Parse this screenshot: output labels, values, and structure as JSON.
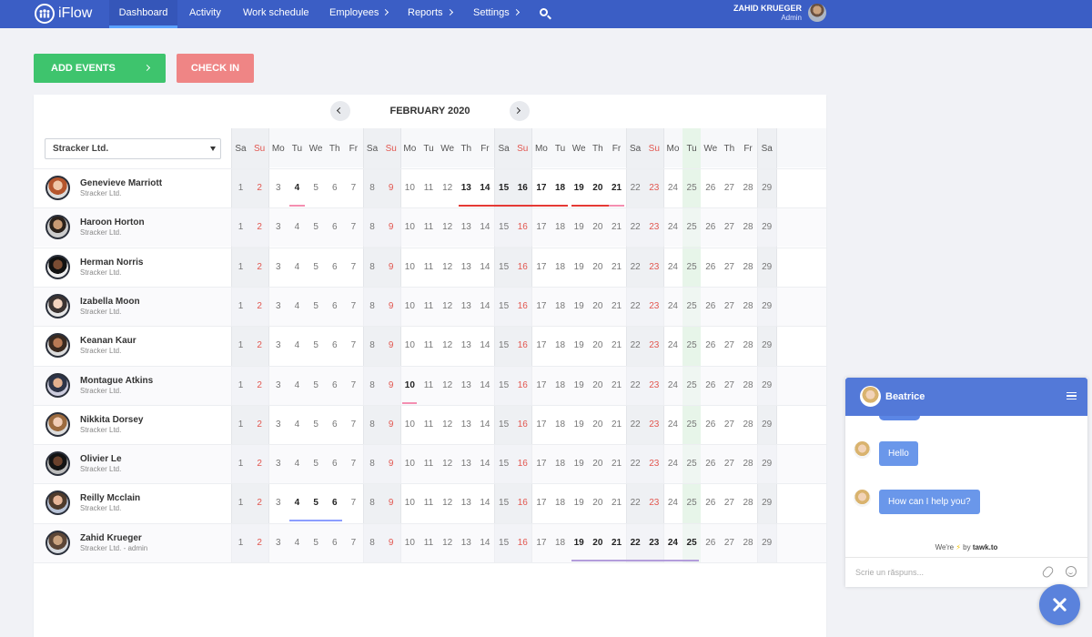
{
  "app": {
    "name": "iFlow"
  },
  "nav": {
    "items": [
      {
        "label": "Dashboard",
        "active": true,
        "chevron": false
      },
      {
        "label": "Activity",
        "chevron": false
      },
      {
        "label": "Work schedule",
        "chevron": false
      },
      {
        "label": "Employees",
        "chevron": true
      },
      {
        "label": "Reports",
        "chevron": true
      },
      {
        "label": "Settings",
        "chevron": true
      }
    ],
    "search_icon": "search-icon"
  },
  "user": {
    "name": "ZAHID KRUEGER",
    "role": "Admin"
  },
  "actions": {
    "add_events_label": "ADD EVENTS",
    "check_in_label": "CHECK IN"
  },
  "calendar": {
    "month_label": "FEBRUARY 2020",
    "company_filter": "Stracker Ltd.",
    "day_names": [
      "Sa",
      "Su",
      "Mo",
      "Tu",
      "We",
      "Th",
      "Fr",
      "Sa",
      "Su",
      "Mo",
      "Tu",
      "We",
      "Th",
      "Fr",
      "Sa",
      "Su",
      "Mo",
      "Tu",
      "We",
      "Th",
      "Fr",
      "Sa",
      "Su",
      "Mo",
      "Tu",
      "We",
      "Th",
      "Fr",
      "Sa"
    ],
    "dates": [
      "1",
      "2",
      "3",
      "4",
      "5",
      "6",
      "7",
      "8",
      "9",
      "10",
      "11",
      "12",
      "13",
      "14",
      "15",
      "16",
      "17",
      "18",
      "19",
      "20",
      "21",
      "22",
      "23",
      "24",
      "25",
      "26",
      "27",
      "28",
      "29"
    ],
    "weekend_dates": [
      1,
      2,
      8,
      9,
      15,
      16,
      22,
      23,
      29
    ],
    "sunday_dates": [
      2,
      9,
      16,
      23
    ],
    "today": 25,
    "employees": [
      {
        "name": "Genevieve Marriott",
        "company": "Stracker Ltd.",
        "bold_dates": [
          4,
          13,
          14,
          15,
          16,
          17,
          18,
          19,
          20,
          21
        ],
        "events": [
          {
            "from": 4,
            "to": 4,
            "color": "#f48fb1"
          },
          {
            "from": 13,
            "to": 18,
            "color": "#e53935"
          },
          {
            "from": 19,
            "to": 21,
            "color": "#e53935"
          },
          {
            "from": 21,
            "to": 21,
            "color": "#f48fb1"
          }
        ]
      },
      {
        "name": "Haroon Horton",
        "company": "Stracker Ltd.",
        "bold_dates": [],
        "events": []
      },
      {
        "name": "Herman Norris",
        "company": "Stracker Ltd.",
        "bold_dates": [],
        "events": []
      },
      {
        "name": "Izabella Moon",
        "company": "Stracker Ltd.",
        "bold_dates": [],
        "events": []
      },
      {
        "name": "Keanan Kaur",
        "company": "Stracker Ltd.",
        "bold_dates": [],
        "events": []
      },
      {
        "name": "Montague Atkins",
        "company": "Stracker Ltd.",
        "bold_dates": [
          10
        ],
        "events": [
          {
            "from": 10,
            "to": 10,
            "color": "#f48fb1"
          }
        ]
      },
      {
        "name": "Nikkita Dorsey",
        "company": "Stracker Ltd.",
        "bold_dates": [],
        "events": []
      },
      {
        "name": "Olivier Le",
        "company": "Stracker Ltd.",
        "bold_dates": [],
        "events": []
      },
      {
        "name": "Reilly Mcclain",
        "company": "Stracker Ltd.",
        "bold_dates": [
          4,
          5,
          6
        ],
        "events": [
          {
            "from": 4,
            "to": 6,
            "color": "#8c9eff"
          }
        ]
      },
      {
        "name": "Zahid Krueger",
        "company": "Stracker Ltd. - admin",
        "bold_dates": [
          19,
          20,
          21,
          22,
          23,
          24,
          25
        ],
        "events": [
          {
            "from": 19,
            "to": 25,
            "color": "#b39ddb"
          }
        ]
      }
    ]
  },
  "chat": {
    "agent_name": "Beatrice",
    "messages": [
      "Hello",
      "How can I help you?"
    ],
    "powered_prefix": "We're",
    "powered_by": "by",
    "powered_brand": "tawk.to",
    "input_placeholder": "Scrie un răspuns..."
  }
}
